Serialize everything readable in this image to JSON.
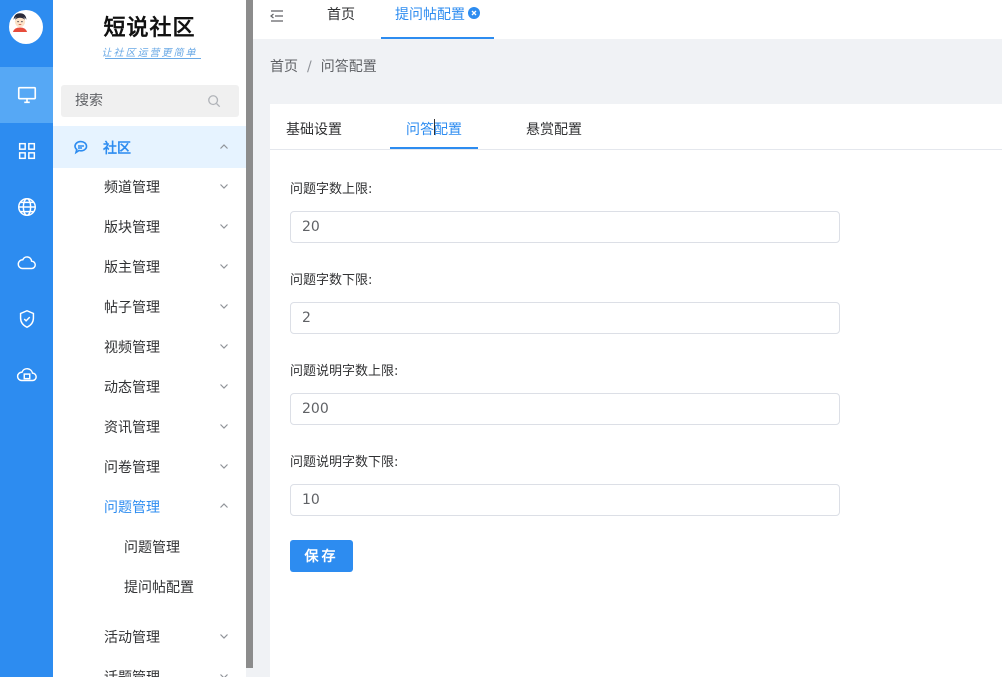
{
  "brand": {
    "title": "短说社区",
    "subtitle": "让社区运营更简单"
  },
  "rail": {
    "items": [
      {
        "icon": "monitor-icon"
      },
      {
        "icon": "grid-icon"
      },
      {
        "icon": "globe-icon"
      },
      {
        "icon": "cloud-icon"
      },
      {
        "icon": "shield-check-icon"
      },
      {
        "icon": "cloud-app-icon"
      }
    ]
  },
  "sidebar": {
    "search_placeholder": "搜索",
    "group_label": "社区",
    "items": [
      {
        "label": "频道管理"
      },
      {
        "label": "版块管理"
      },
      {
        "label": "版主管理"
      },
      {
        "label": "帖子管理"
      },
      {
        "label": "视频管理"
      },
      {
        "label": "动态管理"
      },
      {
        "label": "资讯管理"
      },
      {
        "label": "问卷管理"
      },
      {
        "label": "问题管理"
      },
      {
        "label": "活动管理"
      },
      {
        "label": "话题管理"
      }
    ],
    "subitems": [
      {
        "label": "问题管理"
      },
      {
        "label": "提问帖配置"
      }
    ]
  },
  "topbar": {
    "tabs": [
      {
        "label": "首页"
      },
      {
        "label": "提问帖配置"
      }
    ]
  },
  "breadcrumb": {
    "home": "首页",
    "separator": "/",
    "current": "问答配置"
  },
  "panel": {
    "tabs": [
      {
        "label": "基础设置"
      },
      {
        "label": "问答配置"
      },
      {
        "label": "悬赏配置"
      }
    ],
    "fields": [
      {
        "label": "问题字数上限:",
        "value": "20"
      },
      {
        "label": "问题字数下限:",
        "value": "2"
      },
      {
        "label": "问题说明字数上限:",
        "value": "200"
      },
      {
        "label": "问题说明字数下限:",
        "value": "10"
      }
    ],
    "save_label": "保存"
  },
  "colors": {
    "accent": "#2d8cf0",
    "rail_active": "#56a8f5",
    "group_bg": "#e6f3ff"
  }
}
